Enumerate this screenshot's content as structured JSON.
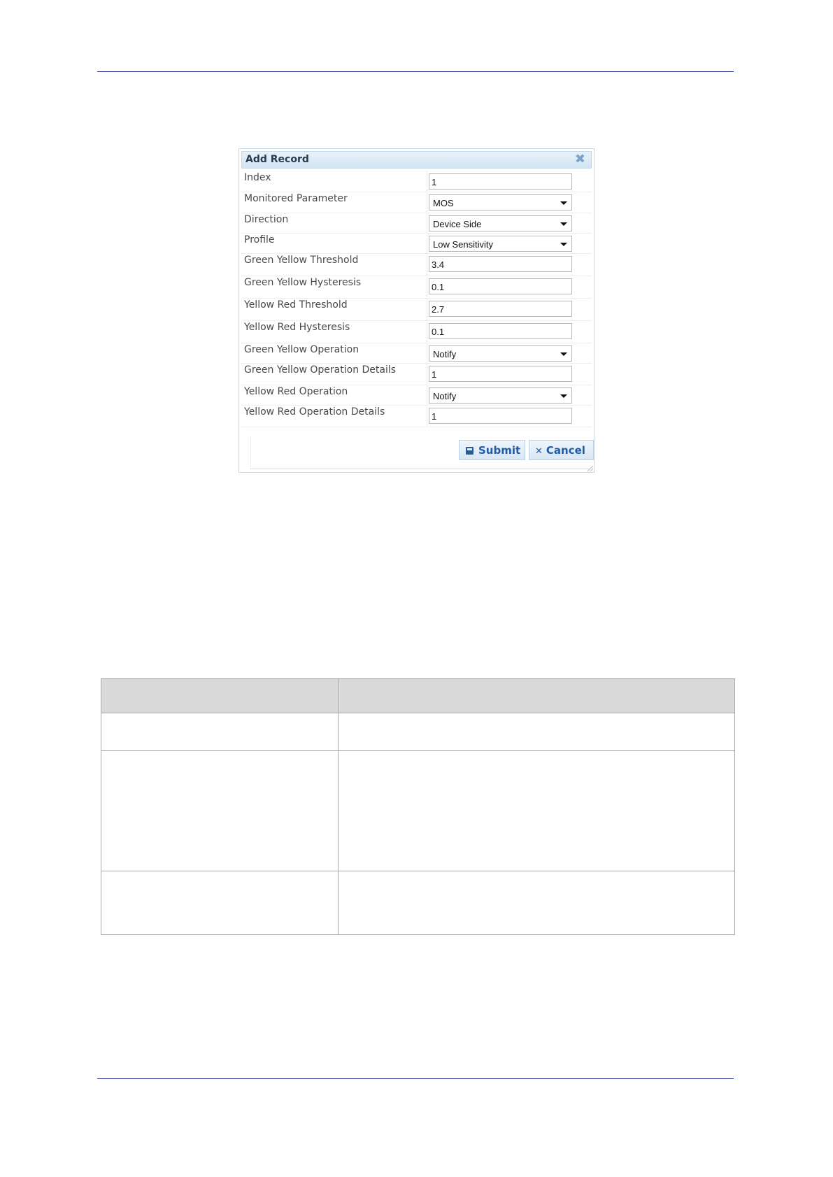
{
  "dialog": {
    "title": "Add Record",
    "close_icon": "close-icon",
    "fields": [
      {
        "label": "Index",
        "type": "text",
        "value": "1"
      },
      {
        "label": "Monitored Parameter",
        "type": "select",
        "value": "MOS"
      },
      {
        "label": "Direction",
        "type": "select",
        "value": "Device Side"
      },
      {
        "label": "Profile",
        "type": "select",
        "value": "Low Sensitivity"
      },
      {
        "label": "Green Yellow Threshold",
        "type": "text",
        "value": "3.4"
      },
      {
        "label": "Green Yellow Hysteresis",
        "type": "text",
        "value": "0.1"
      },
      {
        "label": "Yellow Red Threshold",
        "type": "text",
        "value": "2.7"
      },
      {
        "label": "Yellow Red Hysteresis",
        "type": "text",
        "value": "0.1"
      },
      {
        "label": "Green Yellow Operation",
        "type": "select",
        "value": "Notify"
      },
      {
        "label": "Green Yellow Operation Details",
        "type": "text",
        "value": "1"
      },
      {
        "label": "Yellow Red Operation",
        "type": "select",
        "value": "Notify"
      },
      {
        "label": "Yellow Red Operation Details",
        "type": "text",
        "value": "1"
      }
    ],
    "submit_label": "Submit",
    "cancel_label": "Cancel"
  },
  "colors": {
    "rule": "#1f2b8f",
    "dialog_title_bg": "#d2e4f3",
    "button_text": "#1f5ba6",
    "table_header_bg": "#dadada",
    "table_border": "#a8a8a8"
  }
}
